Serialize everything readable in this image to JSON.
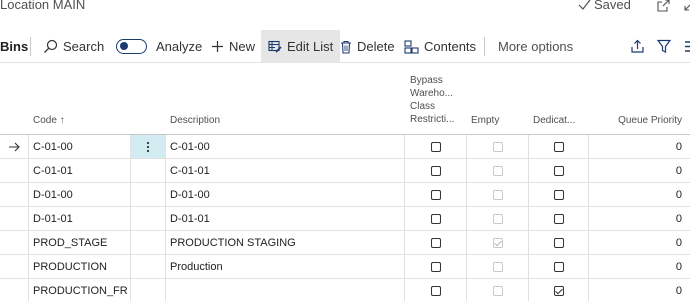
{
  "header": {
    "location_title": "Location MAIN",
    "saved_label": "Saved"
  },
  "actions": {
    "bins_label": "Bins",
    "search_label": "Search",
    "analyze_label": "Analyze",
    "new_label": "New",
    "edit_list_label": "Edit List",
    "delete_label": "Delete",
    "contents_label": "Contents",
    "more_options_label": "More options"
  },
  "columns": {
    "code": "Code",
    "code_sort": "↑",
    "description": "Description",
    "bypass_lines": [
      "Bypass",
      "Wareho...",
      "Class",
      "Restricti..."
    ],
    "empty": "Empty",
    "dedicated": "Dedicat...",
    "queue_priority": "Queue Priority"
  },
  "rows": [
    {
      "code": "C-01-00",
      "description": "C-01-00",
      "bypass": false,
      "empty": false,
      "dedicated": false,
      "queue_priority": "0",
      "active": true
    },
    {
      "code": "C-01-01",
      "description": "C-01-01",
      "bypass": false,
      "empty": false,
      "dedicated": false,
      "queue_priority": "0"
    },
    {
      "code": "D-01-00",
      "description": "D-01-00",
      "bypass": false,
      "empty": false,
      "dedicated": false,
      "queue_priority": "0"
    },
    {
      "code": "D-01-01",
      "description": "D-01-01",
      "bypass": false,
      "empty": false,
      "dedicated": false,
      "queue_priority": "0"
    },
    {
      "code": "PROD_STAGE",
      "description": "PRODUCTION STAGING",
      "bypass": false,
      "empty": true,
      "dedicated": false,
      "queue_priority": "0"
    },
    {
      "code": "PRODUCTION",
      "description": "Production",
      "bypass": false,
      "empty": false,
      "dedicated": false,
      "queue_priority": "0"
    },
    {
      "code": "PRODUCTION_FR",
      "description": "",
      "bypass": false,
      "empty": false,
      "dedicated": true,
      "queue_priority": "0"
    }
  ],
  "icons": {
    "selected_row": "arrow-right-icon",
    "row_menu": "vertical-ellipsis-icon"
  },
  "colors": {
    "accent": "#1b3b6f",
    "active_cell": "#d2ecf2",
    "toolbar_active": "#e6e6e6"
  }
}
